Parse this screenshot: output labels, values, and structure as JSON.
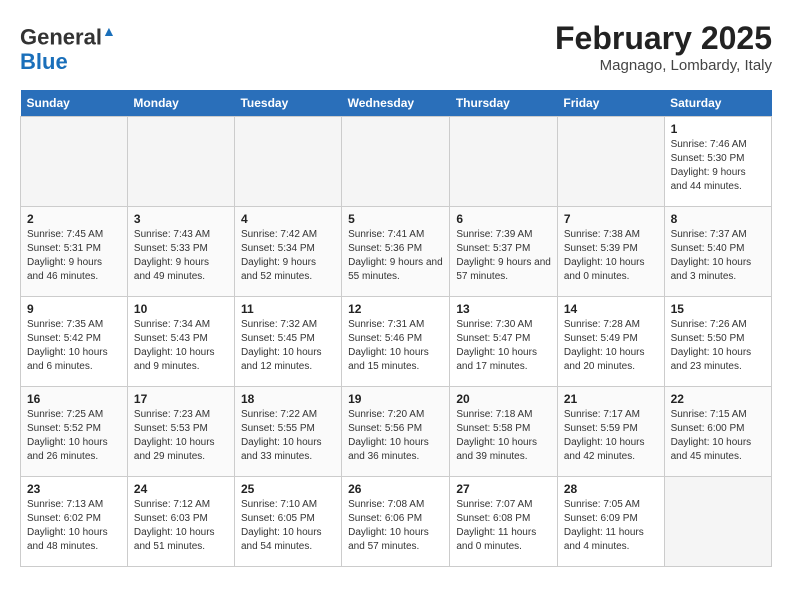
{
  "header": {
    "logo_line1": "General",
    "logo_line2": "Blue",
    "month_year": "February 2025",
    "location": "Magnago, Lombardy, Italy"
  },
  "days_of_week": [
    "Sunday",
    "Monday",
    "Tuesday",
    "Wednesday",
    "Thursday",
    "Friday",
    "Saturday"
  ],
  "weeks": [
    [
      {
        "day": "",
        "info": ""
      },
      {
        "day": "",
        "info": ""
      },
      {
        "day": "",
        "info": ""
      },
      {
        "day": "",
        "info": ""
      },
      {
        "day": "",
        "info": ""
      },
      {
        "day": "",
        "info": ""
      },
      {
        "day": "1",
        "info": "Sunrise: 7:46 AM\nSunset: 5:30 PM\nDaylight: 9 hours and 44 minutes."
      }
    ],
    [
      {
        "day": "2",
        "info": "Sunrise: 7:45 AM\nSunset: 5:31 PM\nDaylight: 9 hours and 46 minutes."
      },
      {
        "day": "3",
        "info": "Sunrise: 7:43 AM\nSunset: 5:33 PM\nDaylight: 9 hours and 49 minutes."
      },
      {
        "day": "4",
        "info": "Sunrise: 7:42 AM\nSunset: 5:34 PM\nDaylight: 9 hours and 52 minutes."
      },
      {
        "day": "5",
        "info": "Sunrise: 7:41 AM\nSunset: 5:36 PM\nDaylight: 9 hours and 55 minutes."
      },
      {
        "day": "6",
        "info": "Sunrise: 7:39 AM\nSunset: 5:37 PM\nDaylight: 9 hours and 57 minutes."
      },
      {
        "day": "7",
        "info": "Sunrise: 7:38 AM\nSunset: 5:39 PM\nDaylight: 10 hours and 0 minutes."
      },
      {
        "day": "8",
        "info": "Sunrise: 7:37 AM\nSunset: 5:40 PM\nDaylight: 10 hours and 3 minutes."
      }
    ],
    [
      {
        "day": "9",
        "info": "Sunrise: 7:35 AM\nSunset: 5:42 PM\nDaylight: 10 hours and 6 minutes."
      },
      {
        "day": "10",
        "info": "Sunrise: 7:34 AM\nSunset: 5:43 PM\nDaylight: 10 hours and 9 minutes."
      },
      {
        "day": "11",
        "info": "Sunrise: 7:32 AM\nSunset: 5:45 PM\nDaylight: 10 hours and 12 minutes."
      },
      {
        "day": "12",
        "info": "Sunrise: 7:31 AM\nSunset: 5:46 PM\nDaylight: 10 hours and 15 minutes."
      },
      {
        "day": "13",
        "info": "Sunrise: 7:30 AM\nSunset: 5:47 PM\nDaylight: 10 hours and 17 minutes."
      },
      {
        "day": "14",
        "info": "Sunrise: 7:28 AM\nSunset: 5:49 PM\nDaylight: 10 hours and 20 minutes."
      },
      {
        "day": "15",
        "info": "Sunrise: 7:26 AM\nSunset: 5:50 PM\nDaylight: 10 hours and 23 minutes."
      }
    ],
    [
      {
        "day": "16",
        "info": "Sunrise: 7:25 AM\nSunset: 5:52 PM\nDaylight: 10 hours and 26 minutes."
      },
      {
        "day": "17",
        "info": "Sunrise: 7:23 AM\nSunset: 5:53 PM\nDaylight: 10 hours and 29 minutes."
      },
      {
        "day": "18",
        "info": "Sunrise: 7:22 AM\nSunset: 5:55 PM\nDaylight: 10 hours and 33 minutes."
      },
      {
        "day": "19",
        "info": "Sunrise: 7:20 AM\nSunset: 5:56 PM\nDaylight: 10 hours and 36 minutes."
      },
      {
        "day": "20",
        "info": "Sunrise: 7:18 AM\nSunset: 5:58 PM\nDaylight: 10 hours and 39 minutes."
      },
      {
        "day": "21",
        "info": "Sunrise: 7:17 AM\nSunset: 5:59 PM\nDaylight: 10 hours and 42 minutes."
      },
      {
        "day": "22",
        "info": "Sunrise: 7:15 AM\nSunset: 6:00 PM\nDaylight: 10 hours and 45 minutes."
      }
    ],
    [
      {
        "day": "23",
        "info": "Sunrise: 7:13 AM\nSunset: 6:02 PM\nDaylight: 10 hours and 48 minutes."
      },
      {
        "day": "24",
        "info": "Sunrise: 7:12 AM\nSunset: 6:03 PM\nDaylight: 10 hours and 51 minutes."
      },
      {
        "day": "25",
        "info": "Sunrise: 7:10 AM\nSunset: 6:05 PM\nDaylight: 10 hours and 54 minutes."
      },
      {
        "day": "26",
        "info": "Sunrise: 7:08 AM\nSunset: 6:06 PM\nDaylight: 10 hours and 57 minutes."
      },
      {
        "day": "27",
        "info": "Sunrise: 7:07 AM\nSunset: 6:08 PM\nDaylight: 11 hours and 0 minutes."
      },
      {
        "day": "28",
        "info": "Sunrise: 7:05 AM\nSunset: 6:09 PM\nDaylight: 11 hours and 4 minutes."
      },
      {
        "day": "",
        "info": ""
      }
    ]
  ]
}
